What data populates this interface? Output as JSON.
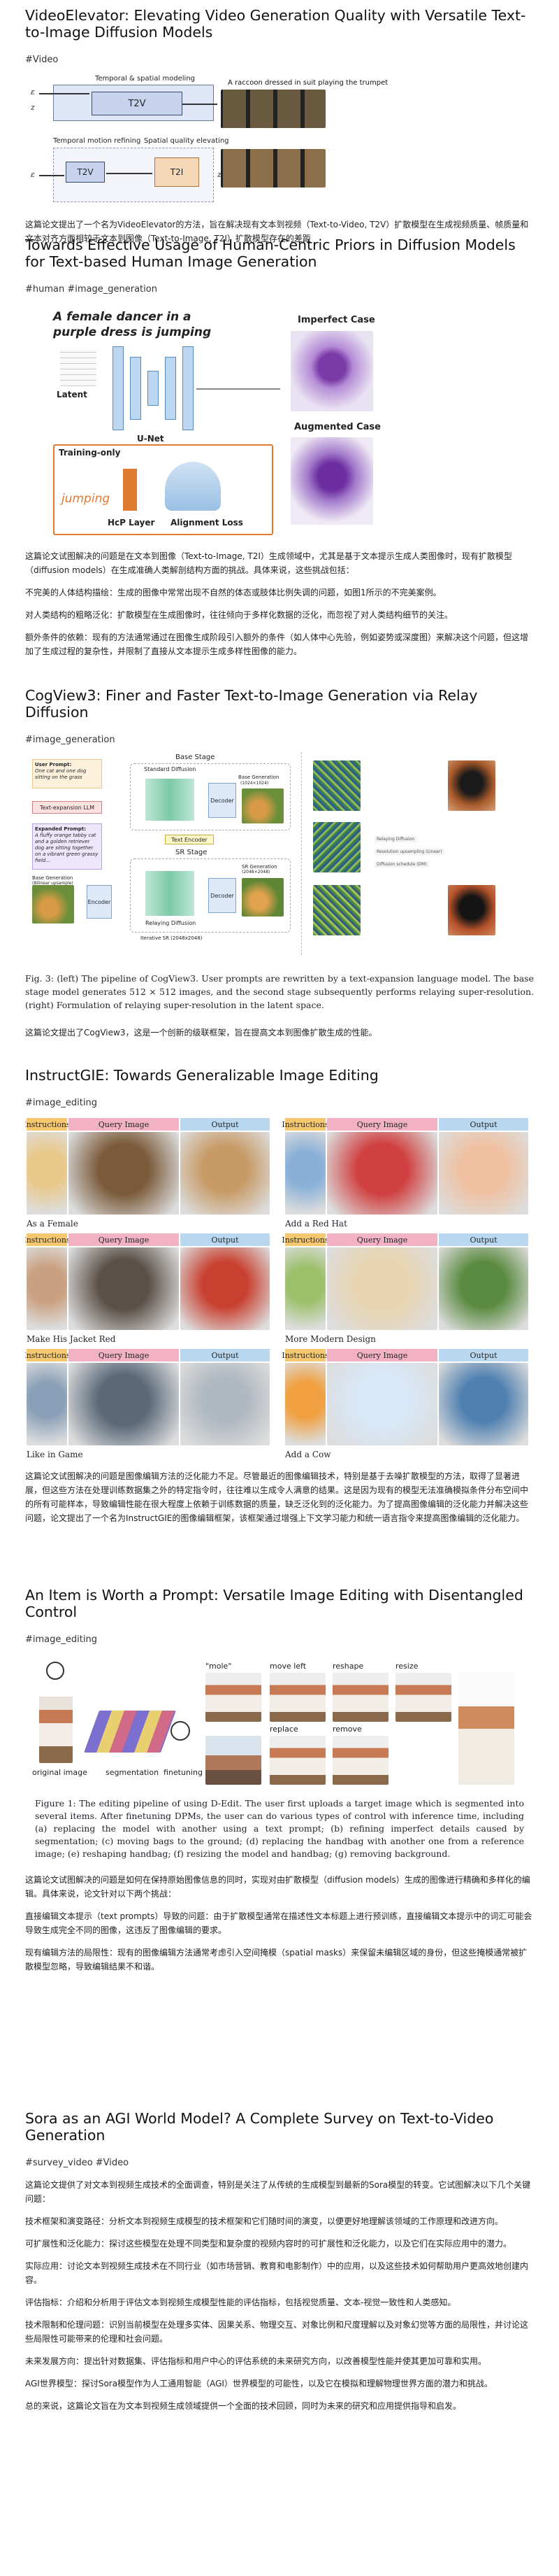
{
  "posts": [
    {
      "title": "VideoElevator: Elevating Video Generation Quality with Versatile Text-to-Image Diffusion Models",
      "tag": "#Video",
      "figure": {
        "top_label": "Temporal & spatial modeling",
        "prompt": "A raccoon dressed in suit playing the trumpet",
        "t2v": "T2V",
        "t2v_small": "T2V",
        "t2i": "T2I",
        "temporal_label": "Temporal motion refining",
        "spatial_label": "Spatial quality elevating",
        "vars": [
          "ε",
          "z",
          "ε",
          "z",
          "t",
          "t",
          "t-1",
          "t-1"
        ]
      },
      "paras": [
        "这篇论文提出了一个名为VideoElevator的方法，旨在解决现有文本到视频（Text-to-Video, T2V）扩散模型在生成视频质量、帧质量和文本对齐方面相较于文本到图像（Text-to-Image, T2I）扩散模型存在的差距"
      ]
    },
    {
      "title": "Towards Effective Usage of Human-Centric Priors in Diffusion Models for Text-based Human Image Generation",
      "tag": "#human #image_generation",
      "figure": {
        "prompt_line1": "A female dancer in a",
        "prompt_line2": "purple dress is jumping",
        "latent": "Latent",
        "unet": "U-Net",
        "training_only": "Training-only",
        "jumping": "jumping",
        "hcp_layer": "HcP Layer",
        "alignment_loss": "Alignment Loss",
        "imperfect": "Imperfect Case",
        "augmented": "Augmented Case"
      },
      "paras": [
        "这篇论文试图解决的问题是在文本到图像（Text-to-Image, T2I）生成领域中，尤其是基于文本提示生成人类图像时，现有扩散模型（diffusion models）在生成准确人类解剖结构方面的挑战。具体来说，这些挑战包括：",
        "不完美的人体结构描绘：生成的图像中常常出现不自然的体态或肢体比例失调的问题，如图1所示的不完美案例。",
        "对人类结构的粗略泛化：扩散模型在生成图像时，往往倾向于多样化数据的泛化，而忽视了对人类结构细节的关注。",
        "额外条件的依赖：现有的方法通常通过在图像生成阶段引入额外的条件（如人体中心先验，例如姿势或深度图）来解决这个问题，但这增加了生成过程的复杂性，并限制了直接从文本提示生成多样性图像的能力。"
      ]
    },
    {
      "title": "CogView3: Finer and Faster Text-to-Image Generation via Relay Diffusion",
      "tag": "#image_generation",
      "figure": {
        "user_prompt_title": "User Prompt:",
        "user_prompt": "One cat and one dog sitting on the grass",
        "llm": "Text-expansion LLM",
        "expanded_title": "Expanded Prompt:",
        "expanded": "A fluffy orange tabby cat and a golden retriever dog are sitting together on a vibrant green grassy field...",
        "base_stage": "Base Stage",
        "standard_diffusion": "Standard Diffusion",
        "decoder": "Decoder",
        "base_generation": "Base Generation",
        "base_res": "(1024×1024)",
        "text_encoder": "Text Encoder",
        "sr_stage": "SR Stage",
        "encoder": "Encoder",
        "relaying": "Relaying Diffusion",
        "sr_generation": "SR Generation",
        "sr_res": "(2048×2048)",
        "base_gen_left": "Base Generation",
        "upsample": "(Bilinear upsample)",
        "iterative": "Iterative SR (2048x2048)",
        "right_labels": [
          "Relaying Diffusion",
          "Resolution upsampling (Linear)",
          "Diffusion schedule (DM)"
        ],
        "caption": "Fig. 3: (left) The pipeline of CogView3. User prompts are rewritten by a text-expansion language model. The base stage model generates 512 × 512 images, and the second stage subsequently performs relaying super-resolution. (right) Formulation of relaying super-resolution in the latent space."
      },
      "paras": [
        "这篇论文提出了CogView3，这是一个创新的级联框架，旨在提高文本到图像扩散生成的性能。"
      ]
    },
    {
      "title": "InstructGIE: Towards Generalizable Image Editing",
      "tag": "#image_editing",
      "figure": {
        "headers": [
          "Instructions",
          "Query Image",
          "Output"
        ],
        "captions": [
          "As a Female",
          "Add a Red Hat",
          "Make His Jacket Red",
          "More Modern Design",
          "Like in Game",
          "Add a Cow"
        ]
      },
      "paras": [
        "这篇论文试图解决的问题是图像编辑方法的泛化能力不足。尽管最近的图像编辑技术，特别是基于去噪扩散模型的方法，取得了显著进展，但这些方法在处理训练数据集之外的特定指令时，往往难以生成令人满意的结果。这是因为现有的模型无法准确模拟条件分布空间中的所有可能样本，导致编辑性能在很大程度上依赖于训练数据的质量，缺乏泛化到的泛化能力。为了提高图像编辑的泛化能力并解决这些问题，论文提出了一个名为InstructGIE的图像编辑框架，该框架通过增强上下文学习能力和统一语言指令来提高图像编辑的泛化能力。"
      ]
    },
    {
      "title": "An Item is Worth a Prompt: Versatile Image Editing with Disentangled Control",
      "tag": "#image_editing",
      "figure": {
        "original": "original image",
        "segmentation": "segmentation",
        "finetuning": "finetuning",
        "ops": [
          "\"mole\"",
          "move left",
          "reshape",
          "resize",
          "replace",
          "remove"
        ],
        "caption": "Figure 1: The editing pipeline of using D-Edit. The user first uploads a target image which is segmented into several items. After finetuning DPMs, the user can do various types of control with inference time, including (a) replacing the model with another using a text prompt; (b) refining imperfect details caused by segmentation; (c) moving bags to the ground; (d) replacing the handbag with another one from a reference image; (e) reshaping handbag; (f) resizing the model and handbag; (g) removing background."
      },
      "paras": [
        "这篇论文试图解决的问题是如何在保持原始图像信息的同时，实现对由扩散模型（diffusion models）生成的图像进行精确和多样化的编辑。具体来说，论文针对以下两个挑战：",
        "直接编辑文本提示（text prompts）导致的问题：由于扩散模型通常在描述性文本标题上进行预训练，直接编辑文本提示中的词汇可能会导致生成完全不同的图像，这违反了图像编辑的要求。",
        "现有编辑方法的局限性：现有的图像编辑方法通常考虑引入空间掩模（spatial masks）来保留未编辑区域的身份，但这些掩模通常被扩散模型忽略，导致编辑结果不和谐。"
      ]
    },
    {
      "title": "Sora as an AGI World Model? A Complete Survey on Text-to-Video Generation",
      "tag": "#survey_video #Video",
      "figure": null,
      "paras": [
        "这篇论文提供了对文本到视频生成技术的全面调查，特别是关注了从传统的生成模型到最新的Sora模型的转变。它试图解决以下几个关键问题：",
        "技术框架和演变路径：分析文本到视频生成模型的技术框架和它们随时间的演变，以便更好地理解该领域的工作原理和改进方向。",
        "可扩展性和泛化能力：探讨这些模型在处理不同类型和复杂度的视频内容时的可扩展性和泛化能力，以及它们在实际应用中的潜力。",
        "实际应用：讨论文本到视频生成技术在不同行业（如市场营销、教育和电影制作）中的应用，以及这些技术如何帮助用户更高效地创建内容。",
        "评估指标：介绍和分析用于评估文本到视频生成模型性能的评估指标，包括视觉质量、文本-视觉一致性和人类感知。",
        "技术限制和伦理问题：识别当前模型在处理多实体、因果关系、物理交互、对象比例和尺度理解以及对象幻觉等方面的局限性，并讨论这些局限性可能带来的伦理和社会问题。",
        "未来发展方向：提出针对数据集、评估指标和用户中心的评估系统的未来研究方向，以改善模型性能并使其更加可靠和实用。",
        "AGI世界模型：探讨Sora模型作为人工通用智能（AGI）世界模型的可能性，以及它在模拟和理解物理世界方面的潜力和挑战。",
        "总的来说，这篇论文旨在为文本到视频生成领域提供一个全面的技术回顾，同时为未来的研究和应用提供指导和启发。"
      ]
    }
  ]
}
